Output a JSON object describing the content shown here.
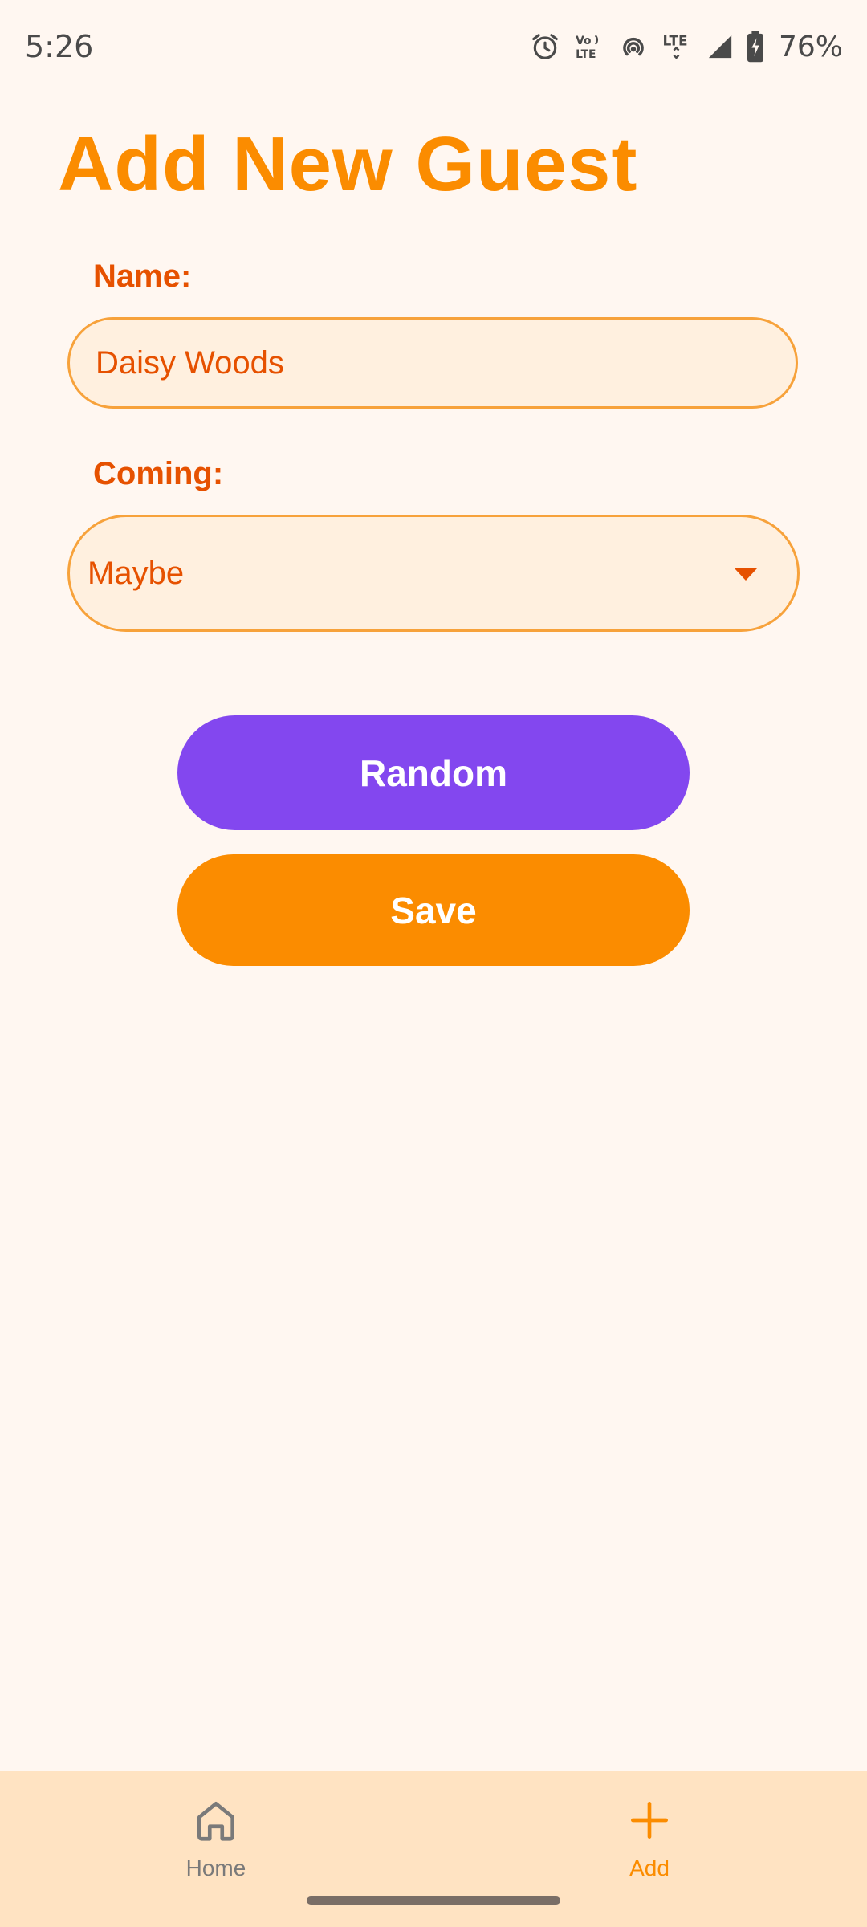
{
  "status_bar": {
    "time": "5:26",
    "battery": "76%",
    "icons": [
      "alarm-icon",
      "volte-icon",
      "hotspot-icon",
      "lte-icon",
      "signal-icon",
      "battery-charging-icon"
    ]
  },
  "page": {
    "title": "Add New Guest"
  },
  "form": {
    "name_label": "Name:",
    "name_value": "Daisy Woods",
    "coming_label": "Coming:",
    "coming_value": "Maybe"
  },
  "buttons": {
    "random_label": "Random",
    "save_label": "Save"
  },
  "bottom_nav": {
    "items": [
      {
        "label": "Home",
        "icon": "home-icon",
        "active": false
      },
      {
        "label": "Add",
        "icon": "plus-icon",
        "active": true
      }
    ]
  },
  "colors": {
    "background": "#FFF7F1",
    "accent_orange": "#FB8C00",
    "label_orange": "#E65100",
    "input_fill": "#FFF0DF",
    "input_border": "#F7A23B",
    "random_purple": "#8347EF",
    "nav_background": "#FFE3C2"
  }
}
